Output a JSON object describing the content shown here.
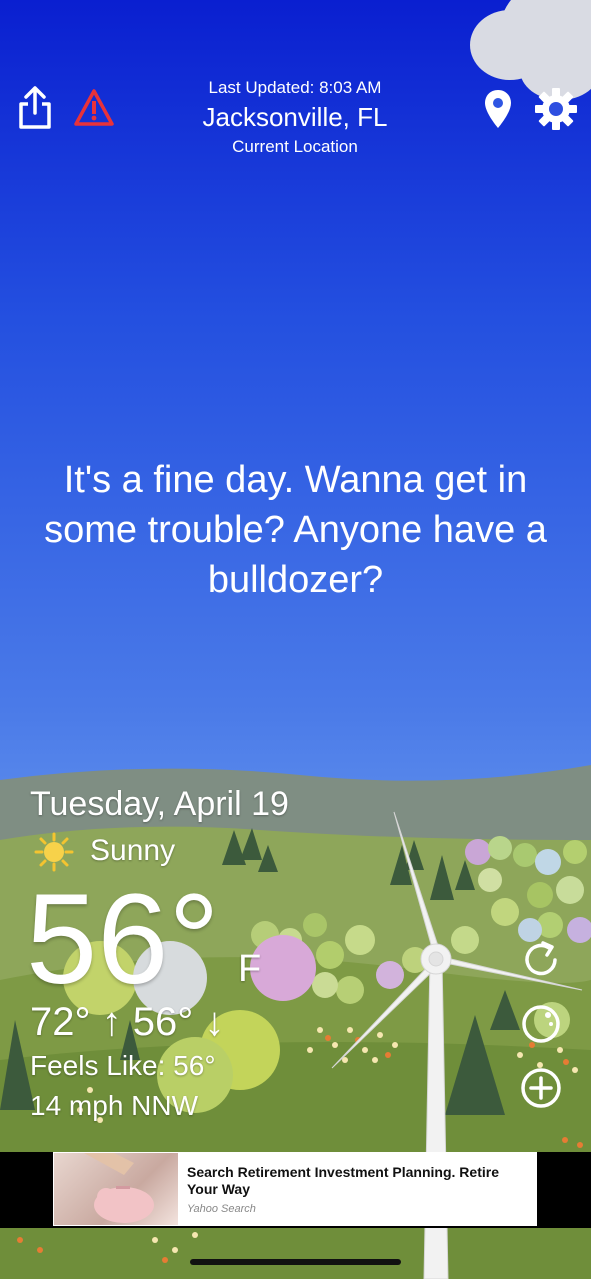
{
  "header": {
    "last_updated": "Last Updated: 8:03 AM",
    "city": "Jacksonville, FL",
    "location_label": "Current Location"
  },
  "quip": "It's a fine day. Wanna get in some trouble? Anyone have a bulldozer?",
  "weather": {
    "date": "Tuesday, April 19",
    "condition": "Sunny",
    "temperature": "56°",
    "unit": "F",
    "high_low": "72° ↑ 56° ↓",
    "feels_like": "Feels Like: 56°",
    "wind": "14 mph NNW"
  },
  "ad": {
    "title": "Search Retirement Investment Planning. Retire Your Way",
    "source": "Yahoo Search"
  },
  "icons": {
    "share": "share-icon",
    "alert": "alert-triangle-icon",
    "location": "location-pin-icon",
    "settings": "gear-icon",
    "refresh": "refresh-icon",
    "radar": "radar-icon",
    "add": "add-icon"
  },
  "colors": {
    "alert": "#e8323a",
    "sky_top": "#0a1fd0",
    "grass": "#7f9a43"
  }
}
